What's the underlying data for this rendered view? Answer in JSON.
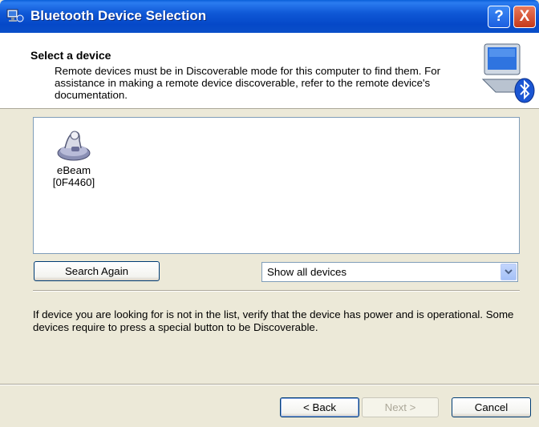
{
  "window": {
    "title": "Bluetooth Device Selection",
    "help_label": "?",
    "close_label": "X"
  },
  "header": {
    "title": "Select a device",
    "description": "Remote devices must be in Discoverable mode for this computer to find them. For assistance in making a remote device discoverable, refer to the remote device's documentation."
  },
  "devices": [
    {
      "name": "eBeam",
      "id": "[0F4460]",
      "icon": "ebeam-device-icon"
    }
  ],
  "actions": {
    "search_again": "Search Again"
  },
  "filter": {
    "selected": "Show all devices"
  },
  "info": {
    "text": "If device you are looking for is not in the list, verify that the device has power and is operational. Some devices require to press a special button to be Discoverable."
  },
  "footer": {
    "back": "< Back",
    "next": "Next >",
    "cancel": "Cancel"
  },
  "colors": {
    "titlebar": "#0548c8",
    "dialog_bg": "#ece9d8"
  }
}
